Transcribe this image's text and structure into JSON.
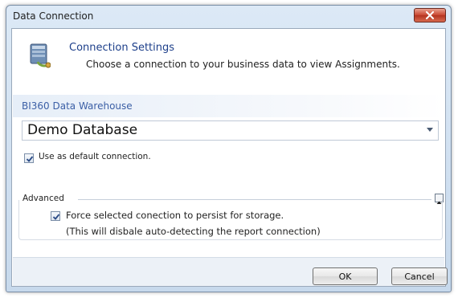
{
  "window": {
    "title": "Data Connection"
  },
  "header": {
    "title": "Connection Settings",
    "subtitle": "Choose a connection to your business data to view Assignments."
  },
  "section": {
    "label": "BI360 Data Warehouse"
  },
  "connection_select": {
    "selected": "Demo Database"
  },
  "default_option": {
    "label": "Use as default connection.",
    "checked": true
  },
  "advanced": {
    "label": "Advanced",
    "force_label": "Force selected conection to persist for storage.",
    "force_checked": true,
    "note": "(This will disbale auto-detecting the report connection)"
  },
  "buttons": {
    "ok": "OK",
    "cancel": "Cancel"
  },
  "colors": {
    "title_text": "#1d3f8a",
    "section_text": "#3b5fa6",
    "close_button": "#c8452f"
  },
  "icons": {
    "header": "database-connection-icon",
    "close": "close-icon",
    "dropdown": "chevron-down-icon",
    "collapse": "collapse-icon"
  }
}
